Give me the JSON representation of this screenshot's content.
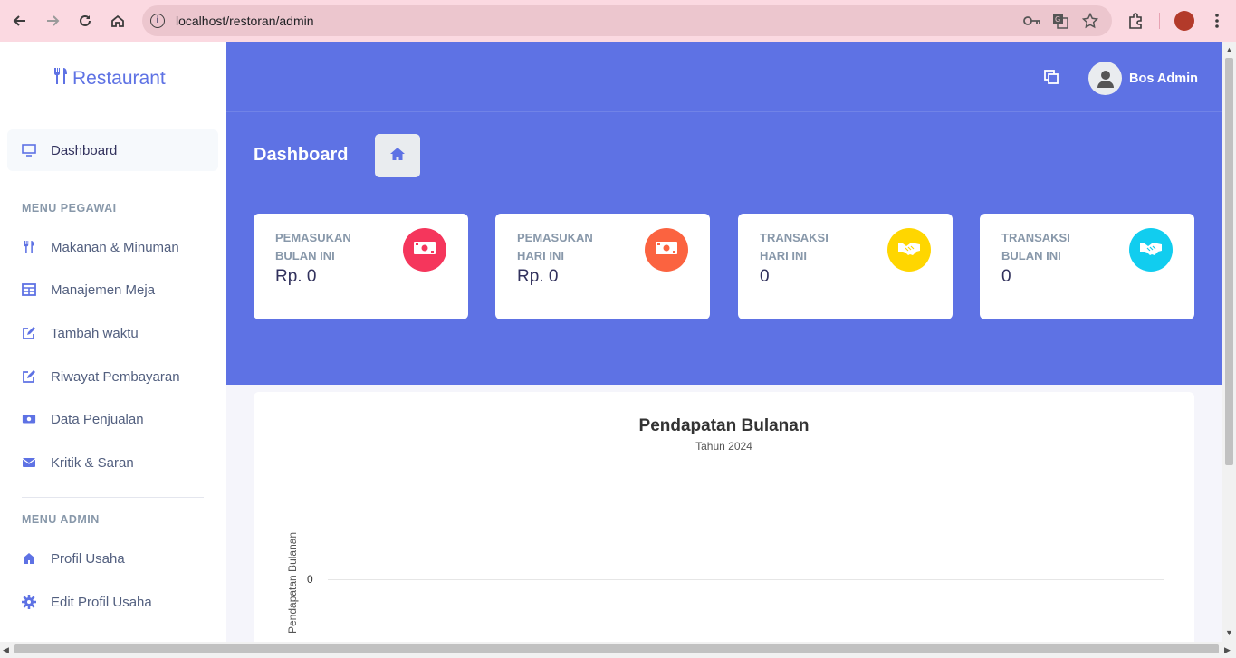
{
  "browser": {
    "url": "localhost/restoran/admin"
  },
  "sidebar": {
    "brand": "Restaurant",
    "active_item": "Dashboard",
    "section_pegawai": "MENU PEGAWAI",
    "pegawai_items": [
      {
        "label": "Makanan & Minuman",
        "icon": "utensils-icon"
      },
      {
        "label": "Manajemen Meja",
        "icon": "table-icon"
      },
      {
        "label": "Tambah waktu",
        "icon": "edit-icon"
      },
      {
        "label": "Riwayat Pembayaran",
        "icon": "edit-icon"
      },
      {
        "label": "Data Penjualan",
        "icon": "money-icon"
      },
      {
        "label": "Kritik & Saran",
        "icon": "envelope-icon"
      }
    ],
    "section_admin": "MENU ADMIN",
    "admin_items": [
      {
        "label": "Profil Usaha",
        "icon": "home-icon"
      },
      {
        "label": "Edit Profil Usaha",
        "icon": "gear-icon"
      }
    ]
  },
  "header": {
    "user_name": "Bos Admin",
    "page_title": "Dashboard"
  },
  "cards": [
    {
      "title": "PEMASUKAN BULAN INI",
      "value": "Rp. 0",
      "icon": "money-bill-icon",
      "color": "#f5365c"
    },
    {
      "title": "PEMASUKAN HARI INI",
      "value": "Rp. 0",
      "icon": "money-bill-icon",
      "color": "#fb6340"
    },
    {
      "title": "TRANSAKSI HARI INI",
      "value": "0",
      "icon": "handshake-icon",
      "color": "#ffd600"
    },
    {
      "title": "TRANSAKSI BULAN INI",
      "value": "0",
      "icon": "handshake-icon",
      "color": "#11cdef"
    }
  ],
  "colors": {
    "primary": "#5e72e4"
  },
  "chart_data": {
    "type": "line",
    "title": "Pendapatan Bulanan",
    "subtitle": "Tahun 2024",
    "ylabel": "Pendapatan Bulanan",
    "y_ticks": [
      "0"
    ],
    "series": []
  }
}
